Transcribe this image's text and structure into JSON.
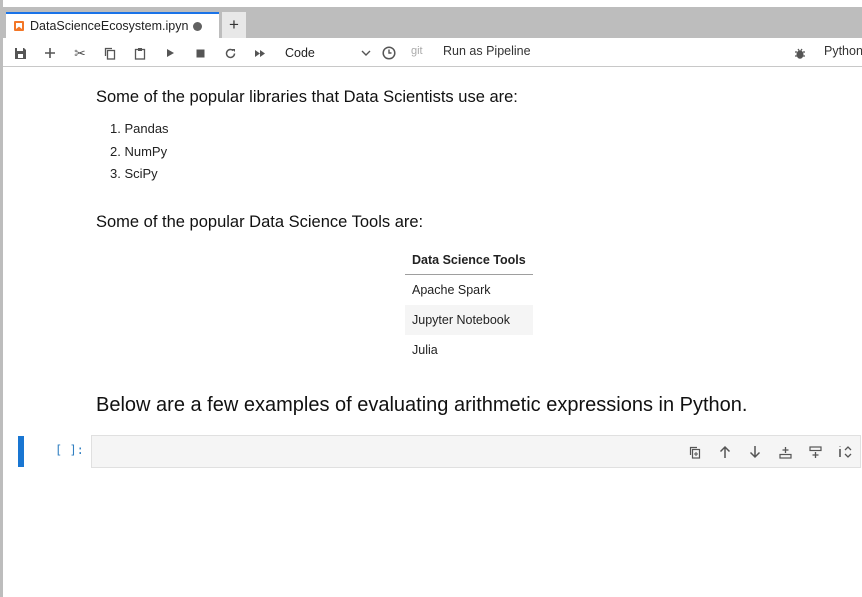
{
  "tabs": [
    {
      "title": "DataScienceEcosystem.ipyn",
      "unsaved": true
    }
  ],
  "toolbar": {
    "cell_type": "Code",
    "git_label": "git",
    "pipeline_label": "Run as Pipeline",
    "kernel_label": "Python"
  },
  "notebook": {
    "libraries_heading": "Some of the popular libraries that Data Scientists use are:",
    "libraries": [
      "1. Pandas",
      "2. NumPy",
      "3. SciPy"
    ],
    "tools_heading": "Some of the popular Data Science Tools are:",
    "tools_table": {
      "header": "Data Science Tools",
      "rows": [
        "Apache Spark",
        "Jupyter Notebook",
        "Julia"
      ]
    },
    "arith_heading": "Below are a few examples of evaluating arithmetic expressions in Python.",
    "code_cell": {
      "prompt": "[ ]:",
      "source": ""
    }
  },
  "icons": {
    "toolbar": [
      "save-icon",
      "add-cell-icon",
      "cut-icon",
      "copy-icon",
      "paste-icon",
      "run-icon",
      "stop-icon",
      "restart-icon",
      "run-all-icon",
      "clock-icon",
      "bug-icon"
    ],
    "cell": [
      "duplicate-icon",
      "move-up-icon",
      "move-down-icon",
      "insert-above-icon",
      "insert-below-icon",
      "more-icon"
    ]
  },
  "colors": {
    "accent": "#1976d2",
    "tab_active_border": "#1a73e8",
    "notebook_icon": "#f37626",
    "prompt": "#307fc1"
  }
}
